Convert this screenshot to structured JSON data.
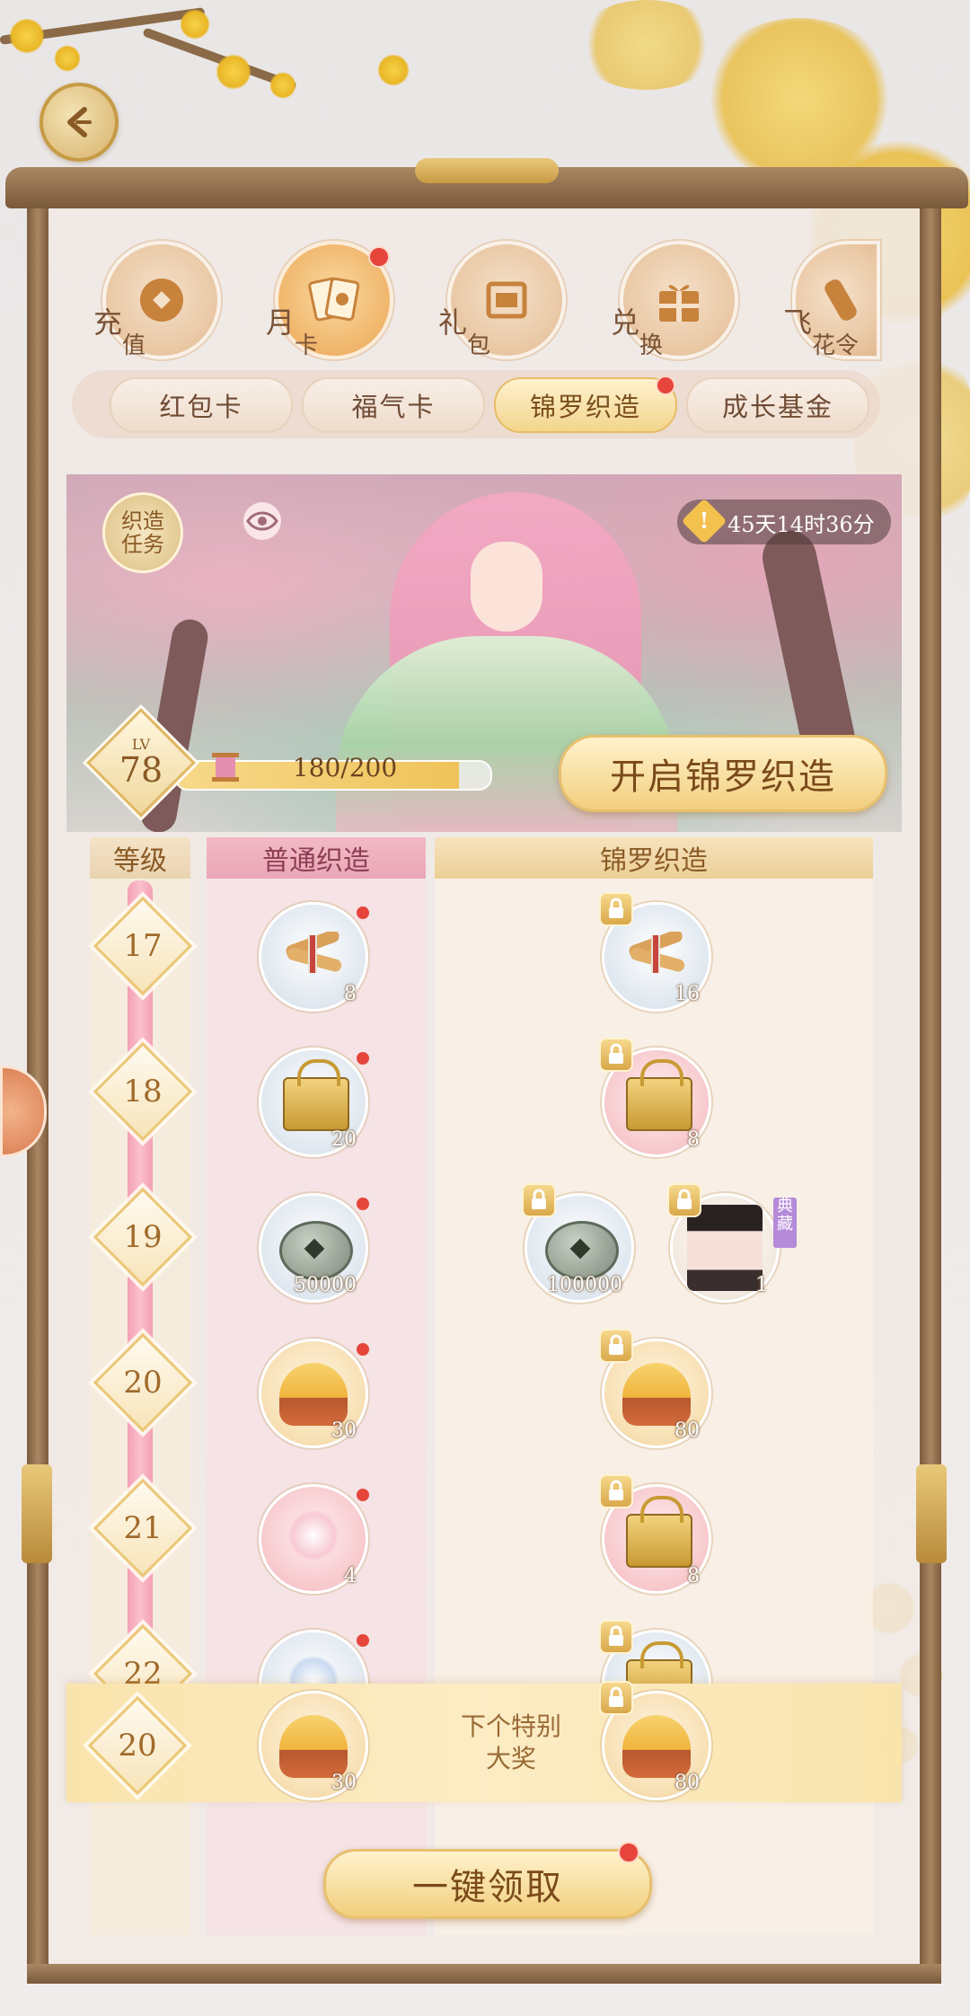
{
  "nav": {
    "back_icon": "back-arrow-icon",
    "categories": [
      {
        "label1": "充",
        "label2": "值",
        "icon": "coin-icon",
        "active": false
      },
      {
        "label1": "月",
        "label2": "卡",
        "icon": "card-icon",
        "active": true,
        "badge": true
      },
      {
        "label1": "礼",
        "label2": "包",
        "icon": "package-icon",
        "active": false
      },
      {
        "label1": "兑",
        "label2": "换",
        "icon": "gift-icon",
        "active": false
      },
      {
        "label1": "飞",
        "label2": "花令",
        "icon": "scroll-icon",
        "active": false
      }
    ]
  },
  "subtabs": [
    {
      "label": "红包卡",
      "active": false
    },
    {
      "label": "福气卡",
      "active": false
    },
    {
      "label": "锦罗织造",
      "active": true,
      "badge": true
    },
    {
      "label": "成长基金",
      "active": false
    }
  ],
  "banner": {
    "quest_line1": "织造",
    "quest_line2": "任务",
    "timer": "45天14时36分",
    "level_prefix": "LV",
    "level": "78",
    "progress_text": "180/200",
    "progress_fraction": 0.9,
    "open_button": "开启锦罗织造"
  },
  "columns": {
    "level": "等级",
    "normal": "普通织造",
    "jinluo": "锦罗织造"
  },
  "rows": [
    {
      "level": "17",
      "normal": {
        "icon": "silk-roll-icon",
        "count": "8",
        "dot": true
      },
      "jinluo": [
        {
          "icon": "silk-roll-icon",
          "count": "16",
          "locked": true
        }
      ]
    },
    {
      "level": "18",
      "normal": {
        "icon": "golden-basket-icon",
        "count": "20",
        "dot": true
      },
      "jinluo": [
        {
          "icon": "golden-basket-icon",
          "count": "8",
          "locked": true,
          "tag": ""
        }
      ]
    },
    {
      "level": "19",
      "normal": {
        "icon": "copper-coin-icon",
        "count": "50000",
        "dot": true
      },
      "jinluo": [
        {
          "icon": "copper-coin-icon",
          "count": "100000",
          "locked": true
        },
        {
          "icon": "portrait-icon",
          "count": "1",
          "locked": true,
          "tag": "典藏"
        }
      ]
    },
    {
      "level": "20",
      "normal": {
        "icon": "mooncake-icon",
        "count": "30",
        "dot": true
      },
      "jinluo": [
        {
          "icon": "mooncake-icon",
          "count": "80",
          "locked": true
        }
      ]
    },
    {
      "level": "21",
      "normal": {
        "icon": "pink-flower-icon",
        "count": "4",
        "dot": true
      },
      "jinluo": [
        {
          "icon": "golden-basket-icon",
          "count": "8",
          "locked": true
        }
      ]
    },
    {
      "level": "22",
      "normal": {
        "icon": "snowflake-icon",
        "count": "",
        "dot": true
      },
      "jinluo": [
        {
          "icon": "golden-basket-icon",
          "count": "",
          "locked": true
        }
      ]
    }
  ],
  "next_reward": {
    "level": "20",
    "line1": "下个特别",
    "line2": "大奖",
    "normal_count": "30",
    "jinluo_count": "80"
  },
  "claim_button": "一键领取",
  "colors": {
    "accent_gold": "#f2cf7e",
    "badge_red": "#e6453c",
    "frame_brown": "#7a5a3b"
  }
}
